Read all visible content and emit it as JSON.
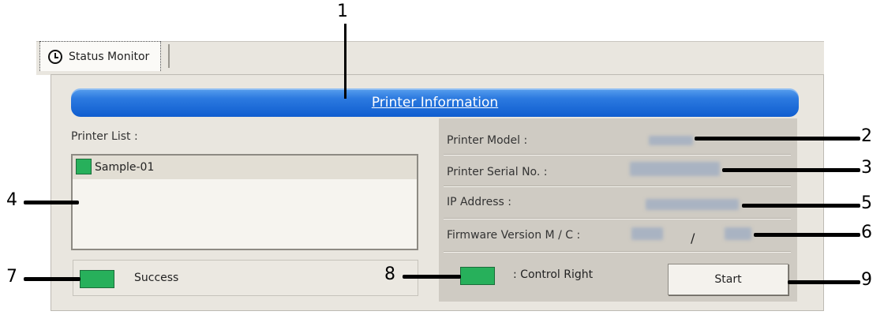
{
  "tab": {
    "label": "Status Monitor",
    "icon": "clock-icon"
  },
  "header": {
    "title": "Printer Information"
  },
  "left": {
    "printer_list_label": "Printer List :",
    "printers": [
      {
        "name": "Sample-01",
        "color": "#27b05b"
      }
    ],
    "status_text": "Success",
    "status_color": "#27b05b"
  },
  "right": {
    "model_label": "Printer Model :",
    "serial_label": "Printer Serial No. :",
    "ip_label": "IP Address :",
    "firmware_label": "Firmware Version M / C :",
    "firmware_sep": "/",
    "control_text": ": Control Right",
    "control_color": "#27b05b",
    "start_label": "Start"
  },
  "callouts": [
    "1",
    "2",
    "3",
    "4",
    "5",
    "6",
    "7",
    "8",
    "9"
  ]
}
